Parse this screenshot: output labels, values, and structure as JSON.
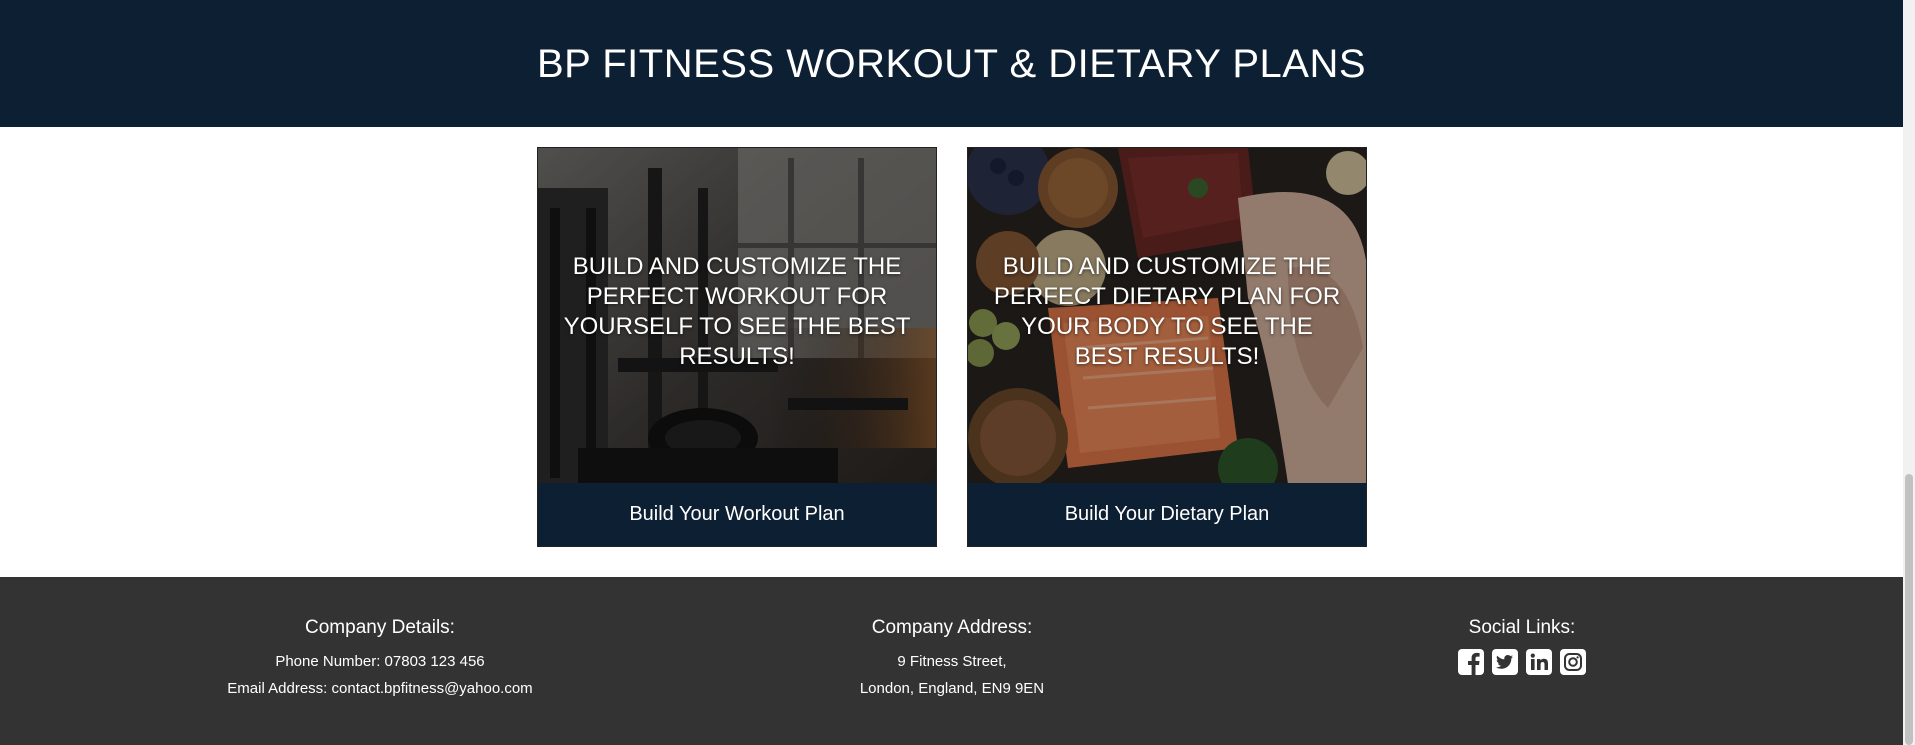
{
  "header": {
    "title": "BP FITNESS WORKOUT & DIETARY PLANS"
  },
  "cards": [
    {
      "overlay_text": "BUILD AND CUSTOMIZE THE PERFECT WORKOUT FOR YOURSELF TO SEE THE BEST RESULTS!",
      "button_label": "Build Your Workout Plan",
      "image": "gym-equipment-photo"
    },
    {
      "overlay_text": "BUILD AND CUSTOMIZE THE PERFECT DIETARY PLAN FOR YOUR BODY TO SEE THE BEST RESULTS!",
      "button_label": "Build Your Dietary Plan",
      "image": "healthy-food-photo"
    }
  ],
  "footer": {
    "details": {
      "heading": "Company Details:",
      "phone": "Phone Number: 07803 123 456",
      "email": "Email Address: contact.bpfitness@yahoo.com"
    },
    "address": {
      "heading": "Company Address:",
      "line1": "9 Fitness Street,",
      "line2": "London, England, EN9 9EN"
    },
    "social": {
      "heading": "Social Links:",
      "icons": [
        "facebook-icon",
        "twitter-icon",
        "linkedin-icon",
        "instagram-icon"
      ]
    }
  },
  "colors": {
    "navy": "#0d1f33",
    "footer_bg": "#333333",
    "text_light": "#ffffff"
  }
}
